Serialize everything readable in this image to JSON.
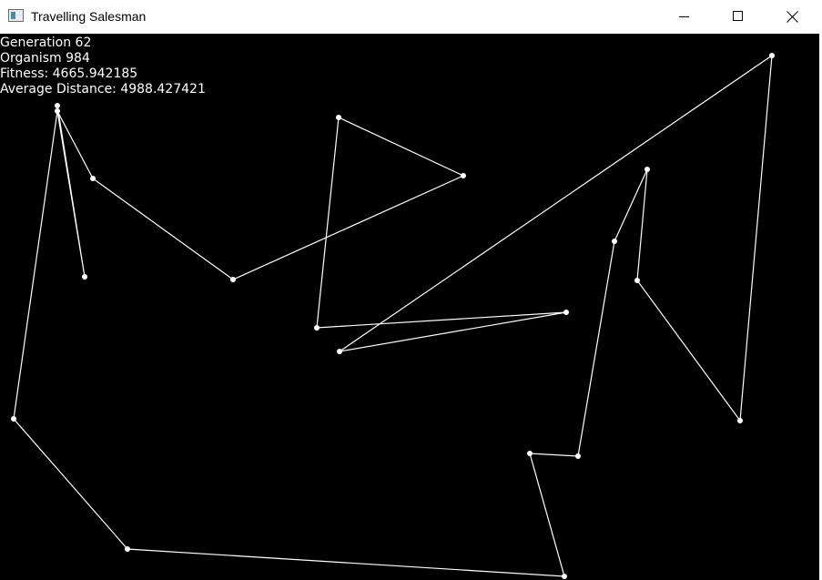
{
  "window": {
    "title": "Travelling Salesman",
    "app_icon": "app-window-icon",
    "controls": [
      {
        "name": "minimize",
        "icon": "minimize-icon"
      },
      {
        "name": "maximize",
        "icon": "maximize-icon"
      },
      {
        "name": "close",
        "icon": "close-icon"
      }
    ]
  },
  "stats": {
    "generation": "Generation 62",
    "organism": "Organism 984",
    "fitness": "Fitness: 4665.942185",
    "average_distance": "Average Distance: 4988.427421"
  },
  "colors": {
    "canvas_background": "#000000",
    "route_color": "#ffffff",
    "text_color": "#ffffff"
  }
}
